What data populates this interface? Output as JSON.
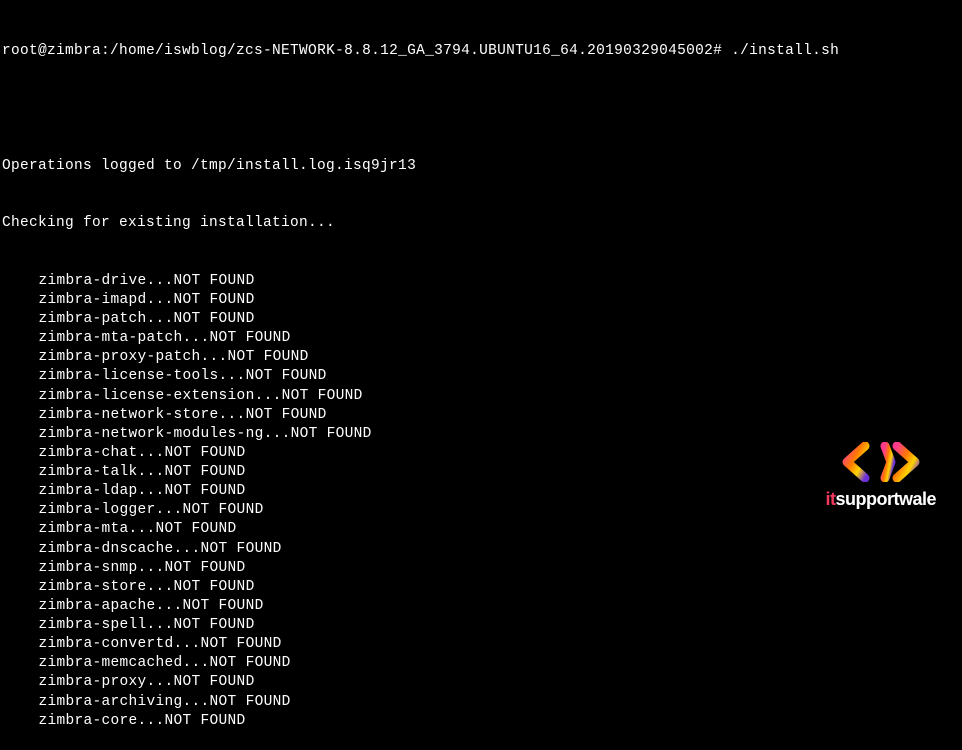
{
  "prompt": {
    "user_host": "root@zimbra",
    "path": "/home/iswblog/zcs-NETWORK-8.8.12_GA_3794.UBUNTU16_64.20190329045002",
    "command": "./install.sh"
  },
  "log_line": "Operations logged to /tmp/install.log.isq9jr13",
  "checking_line": "Checking for existing installation...",
  "not_found": "NOT FOUND",
  "packages": [
    "zimbra-drive",
    "zimbra-imapd",
    "zimbra-patch",
    "zimbra-mta-patch",
    "zimbra-proxy-patch",
    "zimbra-license-tools",
    "zimbra-license-extension",
    "zimbra-network-store",
    "zimbra-network-modules-ng",
    "zimbra-chat",
    "zimbra-talk",
    "zimbra-ldap",
    "zimbra-logger",
    "zimbra-mta",
    "zimbra-dnscache",
    "zimbra-snmp",
    "zimbra-store",
    "zimbra-apache",
    "zimbra-spell",
    "zimbra-convertd",
    "zimbra-memcached",
    "zimbra-proxy",
    "zimbra-archiving",
    "zimbra-core"
  ],
  "watermark": {
    "brand_prefix": "it",
    "brand_rest": "supportwale"
  }
}
